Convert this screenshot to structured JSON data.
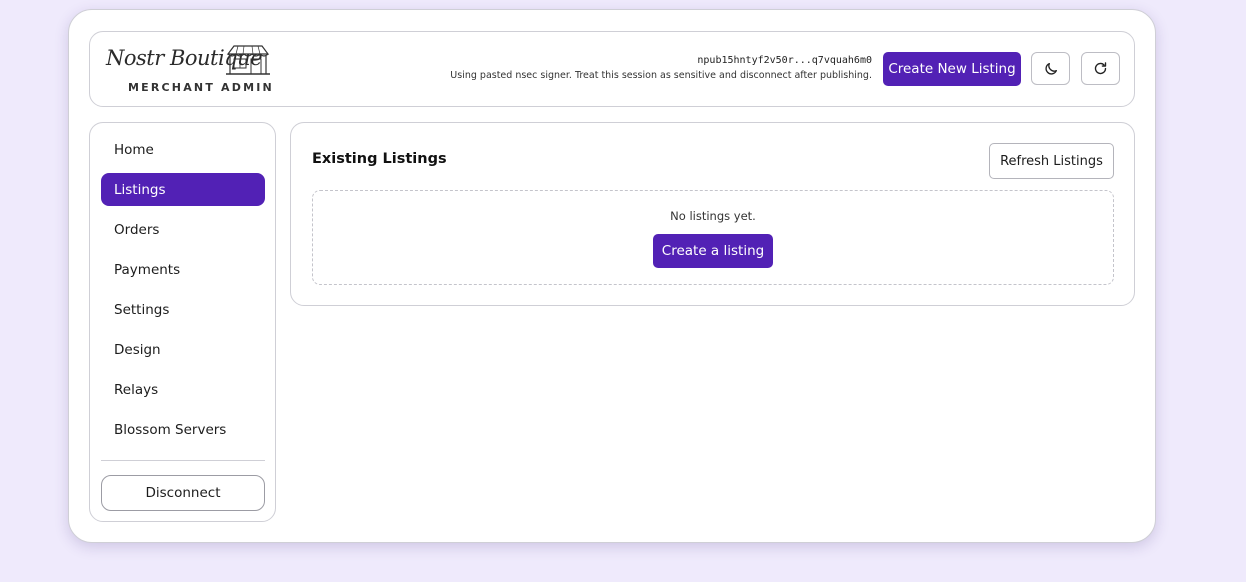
{
  "header": {
    "logo": {
      "script": "Nostr Boutique",
      "subtitle": "MERCHANT ADMIN"
    },
    "signer": {
      "npub": "npub15hntyf2v50r...q7vquah6m0",
      "note": "Using pasted nsec signer. Treat this session as sensitive and disconnect after publishing."
    },
    "create_new_listing_label": "Create New Listing",
    "theme_toggle_icon": "moon-icon",
    "refresh_icon": "refresh-icon"
  },
  "sidebar": {
    "items": [
      {
        "label": "Home",
        "active": false
      },
      {
        "label": "Listings",
        "active": true
      },
      {
        "label": "Orders",
        "active": false
      },
      {
        "label": "Payments",
        "active": false
      },
      {
        "label": "Settings",
        "active": false
      },
      {
        "label": "Design",
        "active": false
      },
      {
        "label": "Relays",
        "active": false
      },
      {
        "label": "Blossom Servers",
        "active": false
      }
    ],
    "disconnect_label": "Disconnect"
  },
  "main": {
    "title": "Existing Listings",
    "refresh_label": "Refresh Listings",
    "empty_text": "No listings yet.",
    "create_listing_label": "Create a listing"
  },
  "colors": {
    "accent": "#5221b5",
    "background": "#efeafc",
    "border": "#cfcfd6"
  }
}
